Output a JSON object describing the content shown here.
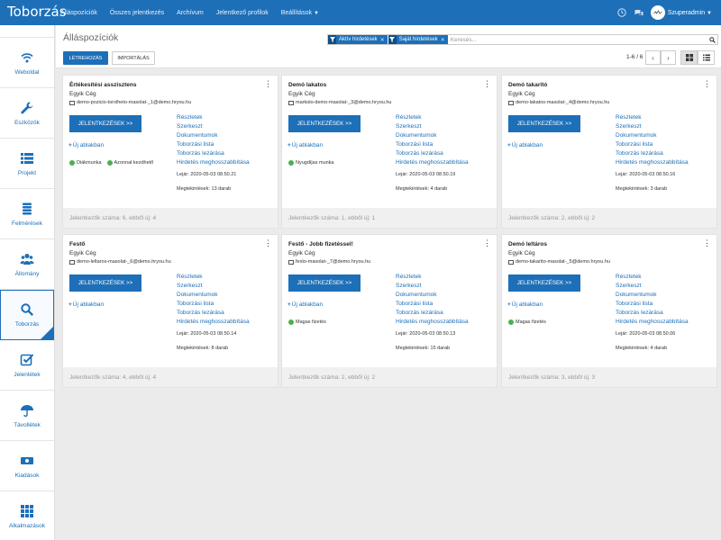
{
  "app": {
    "brand": "Toborzás",
    "nav": [
      {
        "label": "Álláspozíciók"
      },
      {
        "label": "Összes jelentkezés"
      },
      {
        "label": "Archívum"
      },
      {
        "label": "Jelentkező profilok"
      },
      {
        "label": "Beállítások",
        "dropdown": true
      }
    ],
    "user_name": "Szuperadmin",
    "accent_color": "#1d6fb8"
  },
  "sidebar": {
    "items": [
      {
        "label": "Weboldal",
        "icon": "wifi-icon"
      },
      {
        "label": "Eszközök",
        "icon": "wrench-icon"
      },
      {
        "label": "Projekt",
        "icon": "list-icon"
      },
      {
        "label": "Felmérések",
        "icon": "stack-icon"
      },
      {
        "label": "Állomány",
        "icon": "users-icon"
      },
      {
        "label": "Toborzás",
        "icon": "search-icon",
        "active": true
      },
      {
        "label": "Jelenlétek",
        "icon": "checkbox-icon"
      },
      {
        "label": "Távollétek",
        "icon": "umbrella-icon"
      },
      {
        "label": "Kiadások",
        "icon": "money-icon"
      },
      {
        "label": "Alkalmazások",
        "icon": "grid-icon"
      }
    ]
  },
  "page": {
    "title": "Álláspozíciók",
    "filters": [
      "Aktív hirdetések",
      "Saját hirdetések"
    ],
    "search_placeholder": "Keresés...",
    "create_label": "LÉTREHOZÁS",
    "import_label": "IMPORTÁLÁS",
    "pager_text": "1-6 / 6"
  },
  "card_labels": {
    "applications_button": "JELENTKEZÉSEK >>",
    "new_window": "Új ablakban",
    "links": [
      "Részletek",
      "Szerkeszt",
      "Dokumentumok",
      "Toborzási lista",
      "Toborzás lezárása",
      "Hirdetés meghosszabbítása"
    ]
  },
  "cards": [
    {
      "title": "Értékesítési asszisztens",
      "company": "Egyik Cég",
      "email": "demo-pozicio-torolheto-masolat-_1@demo.hryou.hu",
      "tags": [
        "Diákmunka",
        "Azonnal kezdhető"
      ],
      "expiry": "Lejár: 2020-05-03 08.50.21",
      "views": "Megtekintések: 13 darab",
      "footer": "Jelentkezők száma: 6, ebből új: 4"
    },
    {
      "title": "Demó lakatos",
      "company": "Egyik Cég",
      "email": "markolo-demo-masolat-_3@demo.hryou.hu",
      "tags": [
        "Nyugdíjas munka"
      ],
      "expiry": "Lejár: 2020-05-03 08.50.19",
      "views": "Megtekintések: 4 darab",
      "footer": "Jelentkezők száma: 1, ebből új: 1"
    },
    {
      "title": "Demó takarító",
      "company": "Egyik Cég",
      "email": "demo-lakatos-masolat-_4@demo.hryou.hu",
      "tags": [],
      "expiry": "Lejár: 2020-05-03 08.50.16",
      "views": "Megtekintések: 3 darab",
      "footer": "Jelentkezők száma: 2, ebből új: 2"
    },
    {
      "title": "Festő",
      "company": "Egyik Cég",
      "email": "demo-leltaros-masolat-_6@demo.hryou.hu",
      "tags": [],
      "expiry": "Lejár: 2020-05-03 08.50.14",
      "views": "Megtekintések: 8 darab",
      "footer": "Jelentkezők száma: 4, ebből új: 4"
    },
    {
      "title": "Festő - Jobb fizetéssel!",
      "company": "Egyik Cég",
      "email": "festo-masolat-_7@demo.hryou.hu",
      "tags": [
        "Magas fizetés"
      ],
      "expiry": "Lejár: 2020-05-03 08.50.13",
      "views": "Megtekintések: 15 darab",
      "footer": "Jelentkezők száma: 2, ebből új: 2"
    },
    {
      "title": "Demó leltáros",
      "company": "Egyik Cég",
      "email": "demo-takarito-masolat-_5@demo.hryou.hu",
      "tags": [
        "Magas fizetés"
      ],
      "expiry": "Lejár: 2020-05-03 08.50.06",
      "views": "Megtekintések: 4 darab",
      "footer": "Jelentkezők száma: 3, ebből új: 3"
    }
  ]
}
